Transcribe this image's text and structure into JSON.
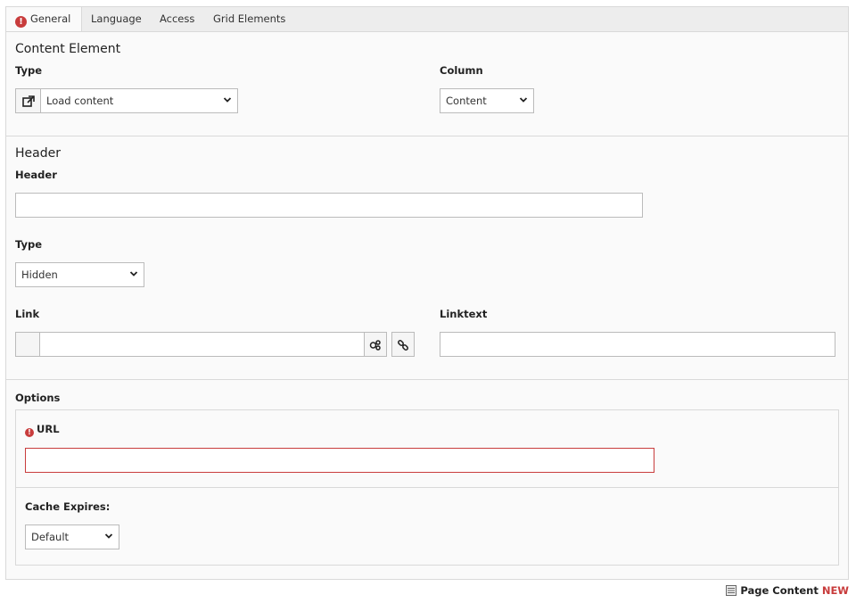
{
  "tabs": [
    {
      "label": "General",
      "has_error": true
    },
    {
      "label": "Language"
    },
    {
      "label": "Access"
    },
    {
      "label": "Grid Elements"
    }
  ],
  "content_element": {
    "title": "Content Element",
    "type_label": "Type",
    "type_value": "Load content",
    "column_label": "Column",
    "column_value": "Content"
  },
  "header_section": {
    "title": "Header",
    "header_label": "Header",
    "header_value": "",
    "type_label": "Type",
    "type_value": "Hidden",
    "link_label": "Link",
    "link_value": "",
    "linktext_label": "Linktext",
    "linktext_value": ""
  },
  "options": {
    "title": "Options",
    "url_label": "URL",
    "url_value": "",
    "cache_label": "Cache Expires:",
    "cache_value": "Default"
  },
  "footer": {
    "record_label": "Page Content",
    "status": "NEW"
  },
  "colors": {
    "error": "#c83c3c",
    "border": "#d9d9d9",
    "panel_bg": "#fafafa",
    "tab_bg": "#ededed"
  }
}
